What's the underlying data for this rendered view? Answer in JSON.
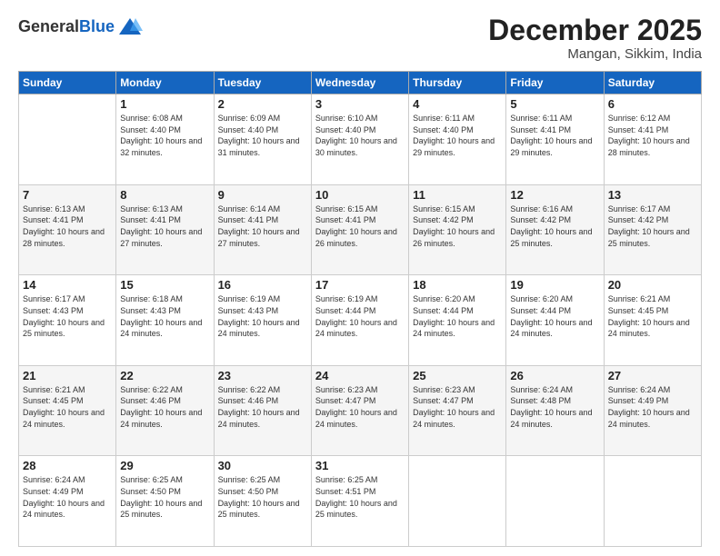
{
  "header": {
    "logo_general": "General",
    "logo_blue": "Blue",
    "month_title": "December 2025",
    "location": "Mangan, Sikkim, India"
  },
  "days_of_week": [
    "Sunday",
    "Monday",
    "Tuesday",
    "Wednesday",
    "Thursday",
    "Friday",
    "Saturday"
  ],
  "weeks": [
    [
      {
        "day": "",
        "sunrise": "",
        "sunset": "",
        "daylight": ""
      },
      {
        "day": "1",
        "sunrise": "Sunrise: 6:08 AM",
        "sunset": "Sunset: 4:40 PM",
        "daylight": "Daylight: 10 hours and 32 minutes."
      },
      {
        "day": "2",
        "sunrise": "Sunrise: 6:09 AM",
        "sunset": "Sunset: 4:40 PM",
        "daylight": "Daylight: 10 hours and 31 minutes."
      },
      {
        "day": "3",
        "sunrise": "Sunrise: 6:10 AM",
        "sunset": "Sunset: 4:40 PM",
        "daylight": "Daylight: 10 hours and 30 minutes."
      },
      {
        "day": "4",
        "sunrise": "Sunrise: 6:11 AM",
        "sunset": "Sunset: 4:40 PM",
        "daylight": "Daylight: 10 hours and 29 minutes."
      },
      {
        "day": "5",
        "sunrise": "Sunrise: 6:11 AM",
        "sunset": "Sunset: 4:41 PM",
        "daylight": "Daylight: 10 hours and 29 minutes."
      },
      {
        "day": "6",
        "sunrise": "Sunrise: 6:12 AM",
        "sunset": "Sunset: 4:41 PM",
        "daylight": "Daylight: 10 hours and 28 minutes."
      }
    ],
    [
      {
        "day": "7",
        "sunrise": "Sunrise: 6:13 AM",
        "sunset": "Sunset: 4:41 PM",
        "daylight": "Daylight: 10 hours and 28 minutes."
      },
      {
        "day": "8",
        "sunrise": "Sunrise: 6:13 AM",
        "sunset": "Sunset: 4:41 PM",
        "daylight": "Daylight: 10 hours and 27 minutes."
      },
      {
        "day": "9",
        "sunrise": "Sunrise: 6:14 AM",
        "sunset": "Sunset: 4:41 PM",
        "daylight": "Daylight: 10 hours and 27 minutes."
      },
      {
        "day": "10",
        "sunrise": "Sunrise: 6:15 AM",
        "sunset": "Sunset: 4:41 PM",
        "daylight": "Daylight: 10 hours and 26 minutes."
      },
      {
        "day": "11",
        "sunrise": "Sunrise: 6:15 AM",
        "sunset": "Sunset: 4:42 PM",
        "daylight": "Daylight: 10 hours and 26 minutes."
      },
      {
        "day": "12",
        "sunrise": "Sunrise: 6:16 AM",
        "sunset": "Sunset: 4:42 PM",
        "daylight": "Daylight: 10 hours and 25 minutes."
      },
      {
        "day": "13",
        "sunrise": "Sunrise: 6:17 AM",
        "sunset": "Sunset: 4:42 PM",
        "daylight": "Daylight: 10 hours and 25 minutes."
      }
    ],
    [
      {
        "day": "14",
        "sunrise": "Sunrise: 6:17 AM",
        "sunset": "Sunset: 4:43 PM",
        "daylight": "Daylight: 10 hours and 25 minutes."
      },
      {
        "day": "15",
        "sunrise": "Sunrise: 6:18 AM",
        "sunset": "Sunset: 4:43 PM",
        "daylight": "Daylight: 10 hours and 24 minutes."
      },
      {
        "day": "16",
        "sunrise": "Sunrise: 6:19 AM",
        "sunset": "Sunset: 4:43 PM",
        "daylight": "Daylight: 10 hours and 24 minutes."
      },
      {
        "day": "17",
        "sunrise": "Sunrise: 6:19 AM",
        "sunset": "Sunset: 4:44 PM",
        "daylight": "Daylight: 10 hours and 24 minutes."
      },
      {
        "day": "18",
        "sunrise": "Sunrise: 6:20 AM",
        "sunset": "Sunset: 4:44 PM",
        "daylight": "Daylight: 10 hours and 24 minutes."
      },
      {
        "day": "19",
        "sunrise": "Sunrise: 6:20 AM",
        "sunset": "Sunset: 4:44 PM",
        "daylight": "Daylight: 10 hours and 24 minutes."
      },
      {
        "day": "20",
        "sunrise": "Sunrise: 6:21 AM",
        "sunset": "Sunset: 4:45 PM",
        "daylight": "Daylight: 10 hours and 24 minutes."
      }
    ],
    [
      {
        "day": "21",
        "sunrise": "Sunrise: 6:21 AM",
        "sunset": "Sunset: 4:45 PM",
        "daylight": "Daylight: 10 hours and 24 minutes."
      },
      {
        "day": "22",
        "sunrise": "Sunrise: 6:22 AM",
        "sunset": "Sunset: 4:46 PM",
        "daylight": "Daylight: 10 hours and 24 minutes."
      },
      {
        "day": "23",
        "sunrise": "Sunrise: 6:22 AM",
        "sunset": "Sunset: 4:46 PM",
        "daylight": "Daylight: 10 hours and 24 minutes."
      },
      {
        "day": "24",
        "sunrise": "Sunrise: 6:23 AM",
        "sunset": "Sunset: 4:47 PM",
        "daylight": "Daylight: 10 hours and 24 minutes."
      },
      {
        "day": "25",
        "sunrise": "Sunrise: 6:23 AM",
        "sunset": "Sunset: 4:47 PM",
        "daylight": "Daylight: 10 hours and 24 minutes."
      },
      {
        "day": "26",
        "sunrise": "Sunrise: 6:24 AM",
        "sunset": "Sunset: 4:48 PM",
        "daylight": "Daylight: 10 hours and 24 minutes."
      },
      {
        "day": "27",
        "sunrise": "Sunrise: 6:24 AM",
        "sunset": "Sunset: 4:49 PM",
        "daylight": "Daylight: 10 hours and 24 minutes."
      }
    ],
    [
      {
        "day": "28",
        "sunrise": "Sunrise: 6:24 AM",
        "sunset": "Sunset: 4:49 PM",
        "daylight": "Daylight: 10 hours and 24 minutes."
      },
      {
        "day": "29",
        "sunrise": "Sunrise: 6:25 AM",
        "sunset": "Sunset: 4:50 PM",
        "daylight": "Daylight: 10 hours and 25 minutes."
      },
      {
        "day": "30",
        "sunrise": "Sunrise: 6:25 AM",
        "sunset": "Sunset: 4:50 PM",
        "daylight": "Daylight: 10 hours and 25 minutes."
      },
      {
        "day": "31",
        "sunrise": "Sunrise: 6:25 AM",
        "sunset": "Sunset: 4:51 PM",
        "daylight": "Daylight: 10 hours and 25 minutes."
      },
      {
        "day": "",
        "sunrise": "",
        "sunset": "",
        "daylight": ""
      },
      {
        "day": "",
        "sunrise": "",
        "sunset": "",
        "daylight": ""
      },
      {
        "day": "",
        "sunrise": "",
        "sunset": "",
        "daylight": ""
      }
    ]
  ]
}
